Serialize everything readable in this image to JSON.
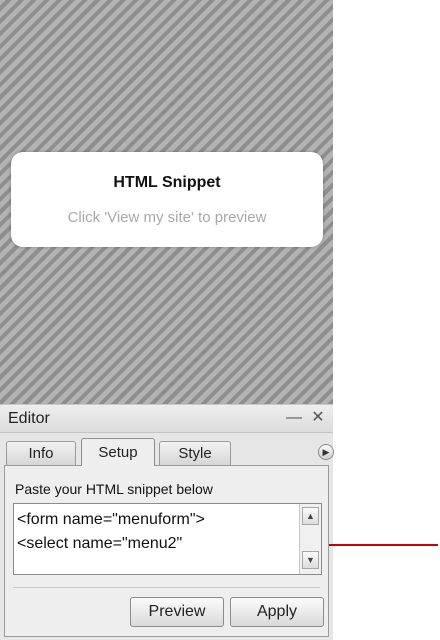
{
  "preview": {
    "card_title": "HTML Snippet",
    "card_hint": "Click 'View my site' to preview"
  },
  "editor": {
    "title": "Editor",
    "minimize_glyph": "—",
    "close_glyph": "✕",
    "tabs": [
      {
        "label": "Info",
        "active": false
      },
      {
        "label": "Setup",
        "active": true
      },
      {
        "label": "Style",
        "active": false
      }
    ],
    "tab_scroll_icon": "play-icon",
    "paste_label": "Paste your HTML snippet below",
    "code_value": "<form name=\"menuform\">\n<select name=\"menu2\"",
    "scroll_up_icon": "triangle-up-icon",
    "scroll_down_icon": "triangle-down-icon",
    "buttons": {
      "preview": "Preview",
      "apply": "Apply"
    }
  },
  "annotation": {
    "arrow_color": "#cc0000",
    "points_to": "code-input"
  }
}
